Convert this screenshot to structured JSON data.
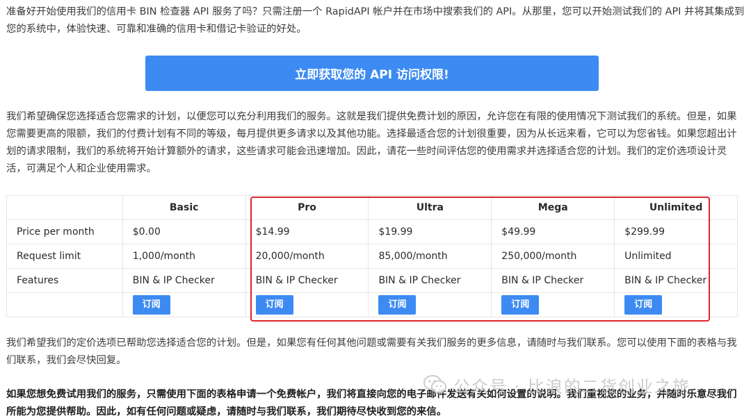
{
  "intro": "准备好开始使用我们的信用卡 BIN 检查器 API 服务了吗？只需注册一个 RapidAPI 帐户并在市场中搜索我们的 API。从那里，您可以开始测试我们的 API 并将其集成到您的系统中，体验快速、可靠和准确的信用卡和借记卡验证的好处。",
  "cta_label": "立即获取您的 API 访问权限!",
  "plan_text": "我们希望确保您选择适合您需求的计划，以便您可以充分利用我们的服务。这就是我们提供免费计划的原因，允许您在有限的使用情况下测试我们的系统。但是，如果您需要更高的限额，我们的付费计划有不同的等级，每月提供更多请求以及其他功能。选择最适合您的计划很重要，因为从长远来看，它可以为您省钱。如果您超出计划的请求限制，我们的系统将开始计算额外的请求，这些请求可能会迅速增加。因此，请花一些时间评估您的使用需求并选择适合您的计划。我们的定价选项设计灵活，可满足个人和企业使用需求。",
  "pricing": {
    "headers": [
      "",
      "Basic",
      "Pro",
      "Ultra",
      "Mega",
      "Unlimited"
    ],
    "rows": [
      {
        "label": "Price per month",
        "values": [
          "$0.00",
          "$14.99",
          "$19.99",
          "$49.99",
          "$299.99"
        ]
      },
      {
        "label": "Request limit",
        "values": [
          "1,000/month",
          "20,000/month",
          "85,000/month",
          "250,000/month",
          "Unlimited"
        ]
      },
      {
        "label": "Features",
        "values": [
          "BIN & IP Checker",
          "BIN & IP Checker",
          "BIN & IP Checker",
          "BIN & IP Checker",
          "BIN & IP Checker"
        ]
      }
    ],
    "subscribe_label": "订阅"
  },
  "outro": "我们希望我们的定价选项已帮助您选择适合您的计划。但是，如果您有任何其他问题或需要有关我们服务的更多信息，请随时与我们联系。您可以使用下面的表格与我们联系，我们会尽快回复。",
  "bold_text": "如果您想免费试用我们的服务，只需使用下面的表格申请一个免费帐户，我们将直接向您的电子邮件发送有关如何设置的说明。我们重视您的业务，并随时乐意尽我们所能为您提供帮助。因此，如有任何问题或疑虑，请随时与我们联系，我们期待尽快收到您的来信。",
  "watermark": "公众号 · 比浪的二货创业之旅",
  "colors": {
    "accent": "#3d8bf2",
    "highlight": "#e0242b"
  }
}
